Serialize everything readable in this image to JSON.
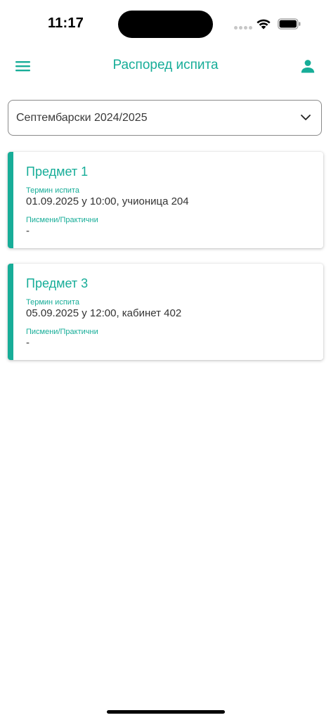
{
  "status_bar": {
    "time": "11:17",
    "icons": [
      "signal-dots-icon",
      "wifi-icon",
      "battery-icon"
    ]
  },
  "header": {
    "title": "Распоред испита",
    "menu_icon": "menu-icon",
    "profile_icon": "person-icon"
  },
  "term_select": {
    "value": "Септембарски 2024/2025",
    "icon": "chevron-down-icon"
  },
  "exams": [
    {
      "subject": "Предмет 1",
      "term_label": "Термин испита",
      "term_value": "01.09.2025 у 10:00, учионица 204",
      "type_label": "Писмени/Практични",
      "type_value": "-"
    },
    {
      "subject": "Предмет 3",
      "term_label": "Термин испита",
      "term_value": "05.09.2025 у 12:00, кабинет 402",
      "type_label": "Писмени/Практични",
      "type_value": "-"
    }
  ],
  "colors": {
    "accent": "#17ad98",
    "text": "#333333",
    "border": "#8a8a8a",
    "background": "#ffffff"
  }
}
